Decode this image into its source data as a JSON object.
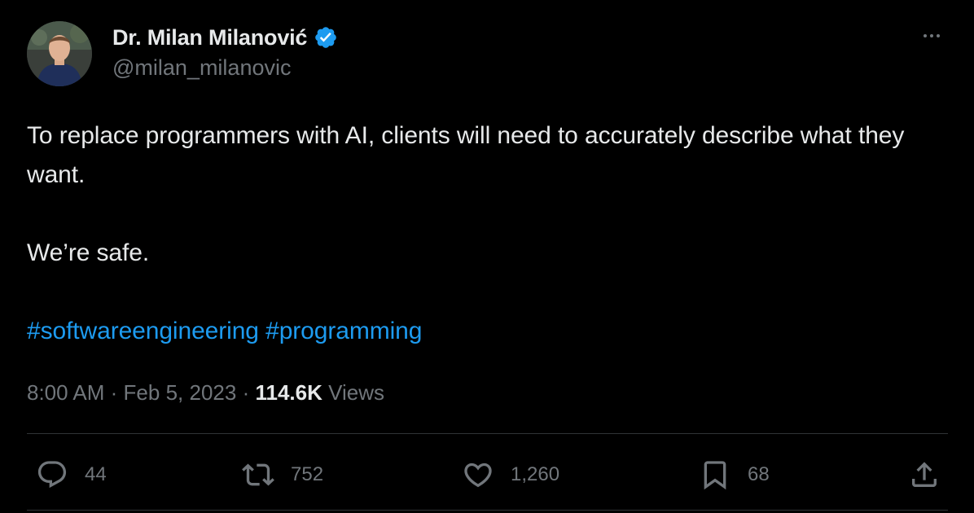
{
  "author": {
    "display_name": "Dr. Milan Milanović",
    "handle": "@milan_milanovic",
    "verified_color": "#1d9bf0"
  },
  "tweet": {
    "line1": "To replace programmers with AI, clients will need to accurately describe what they want.",
    "line2": "We’re safe.",
    "hashtags": [
      "#softwareengineering",
      "#programming"
    ]
  },
  "meta": {
    "time": "8:00 AM",
    "separator": "·",
    "date": "Feb 5, 2023",
    "views_count": "114.6K",
    "views_label": "Views"
  },
  "actions": {
    "replies": "44",
    "retweets": "752",
    "likes": "1,260",
    "bookmarks": "68"
  },
  "colors": {
    "background": "#000000",
    "text": "#e7e9ea",
    "muted": "#71767b",
    "link": "#1d9bf0"
  }
}
